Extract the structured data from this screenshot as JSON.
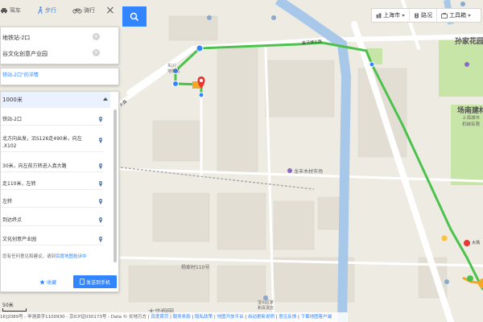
{
  "modes": [
    {
      "label": "驾车",
      "icon": "car-icon"
    },
    {
      "label": "步行",
      "icon": "walk-icon",
      "active": true
    },
    {
      "label": "骑行",
      "icon": "bike-icon"
    }
  ],
  "route": {
    "start": "地铁站-2口",
    "end": "谷文化创意产业园"
  },
  "details_link": "铁站-2口\"的详情",
  "steps": {
    "header": "1000米",
    "items": [
      {
        "text": "铁站-2口"
      },
      {
        "text": "北方向出发，沿S126走490米，向左\n.X102"
      },
      {
        "text": "30米，向左前方转进入真大路"
      },
      {
        "text": "走110米，左转"
      },
      {
        "text": "左转"
      },
      {
        "text": "到达终点"
      },
      {
        "text": "文化创意产业园"
      }
    ],
    "feedback": "您有任何意见和建议，请到",
    "feedback_link": "百度地图投诉中"
  },
  "buttons": {
    "favorite": "收藏",
    "send_to_phone": "发送到手机"
  },
  "top_right": {
    "city": "上海市",
    "traffic": "路况",
    "toolbox": "工具箱"
  },
  "map_labels": {
    "area1": "孙家花园",
    "area2": "场南建材",
    "area2_sub": "上海城市\n机械有限",
    "road1": "走马塘北路",
    "market": "龙丰木材市场",
    "station_label": "东川\n地铁站",
    "bldg": "杨家村110号",
    "bottom1": "宝山区家\n和百货店",
    "bottom2": "大华翔园",
    "road_da": "大华",
    "dayang": "大场",
    "road_left": "大路"
  },
  "scale": "50米",
  "footer": {
    "text": "16]2089号 - 甲测资字1100930 - 京ICP证030173号 - Data © 长地万方 |",
    "links": [
      "百度首页",
      "服务条款",
      "隐私政策",
      "地图开放平台",
      "自动更新说明",
      "意见反馈",
      "下载地图客户端"
    ]
  },
  "colors": {
    "route": "#4cc24c",
    "accent": "#3385ff",
    "water": "#a8c8ea",
    "land": "#eeebe3",
    "block": "#e2ded4",
    "green": "#c8e5a8"
  }
}
